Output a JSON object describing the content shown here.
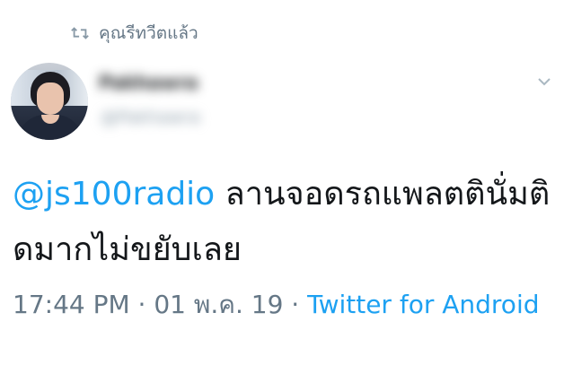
{
  "retweet_bar": {
    "icon": "retweet-icon",
    "label": "คุณรีทวีตแล้ว"
  },
  "author": {
    "avatar": "avatar",
    "display_name": "Pakhawra",
    "handle": "@Pakhawra"
  },
  "menu": {
    "icon": "chevron-down-icon"
  },
  "tweet": {
    "mention": "@js100radio",
    "body": " ลานจอดรถแพลตตินั่มติดมากไม่ขยับเลย"
  },
  "meta": {
    "time": "17:44 PM",
    "separator1": " · ",
    "date": "01 พ.ค. 19",
    "separator2": " · ",
    "source": "Twitter for Android"
  },
  "colors": {
    "link": "#1da1f2",
    "secondary": "#657786",
    "text": "#14171a"
  }
}
